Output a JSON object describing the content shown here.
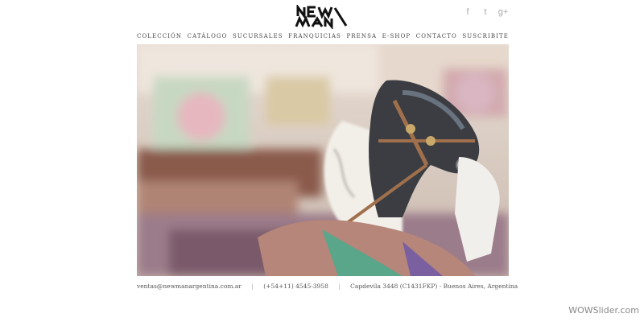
{
  "logo": {
    "text": "NEW MAN"
  },
  "social": [
    {
      "name": "facebook-icon",
      "glyph": "f"
    },
    {
      "name": "twitter-icon",
      "glyph": "t"
    },
    {
      "name": "google-plus-icon",
      "glyph": "g+"
    }
  ],
  "nav": {
    "items": [
      {
        "label": "COLECCIÓN"
      },
      {
        "label": "CATÁLOGO"
      },
      {
        "label": "SUCURSALES"
      },
      {
        "label": "FRANQUICIAS"
      },
      {
        "label": "PRENSA"
      },
      {
        "label": "E-SHOP"
      },
      {
        "label": "CONTACTO"
      },
      {
        "label": "SUSCRIBITE"
      }
    ]
  },
  "footer": {
    "email": "ventas@newmanargentina.com.ar",
    "phone": "(+54+11) 4545-3958",
    "address": "Capdevila 3448 (C1431FKP) - Buenos Aires, Argentina"
  },
  "watermark": "WOWSlider.com"
}
